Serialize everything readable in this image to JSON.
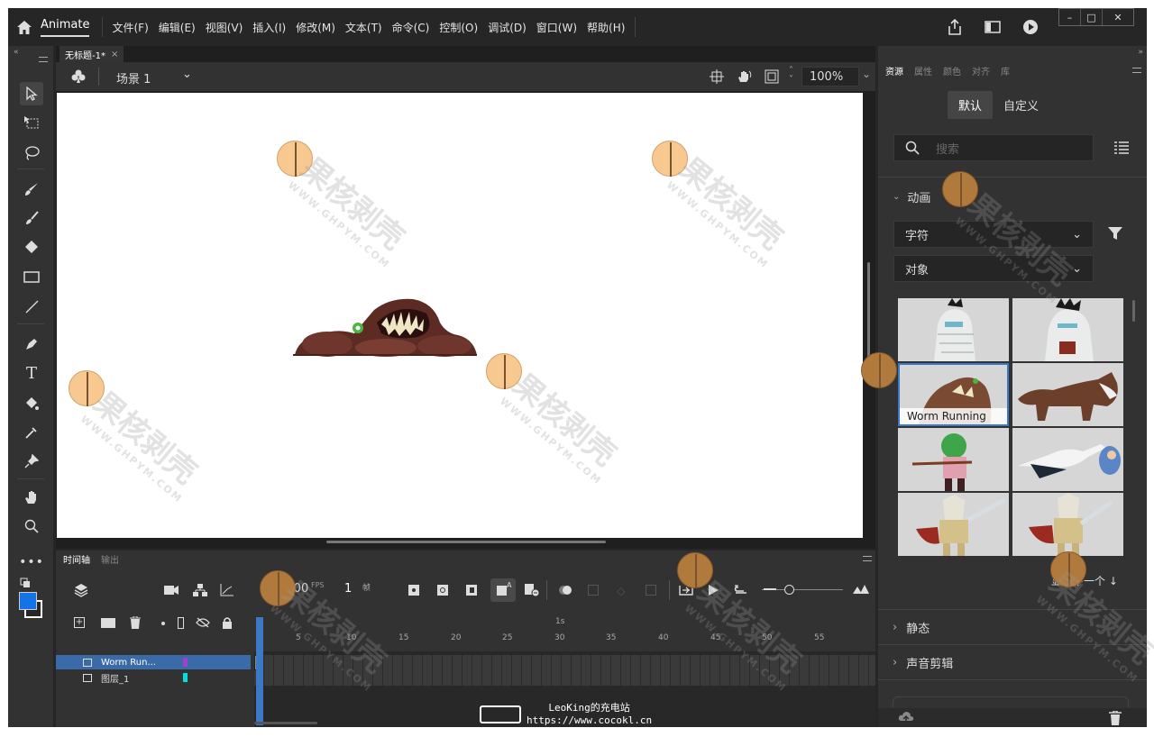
{
  "app": {
    "name": "Animate"
  },
  "menu": [
    "文件(F)",
    "编辑(E)",
    "视图(V)",
    "插入(I)",
    "修改(M)",
    "文本(T)",
    "命令(C)",
    "控制(O)",
    "调试(D)",
    "窗口(W)",
    "帮助(H)"
  ],
  "window_buttons": {
    "minimize": "–",
    "maximize": "□",
    "close": "✕"
  },
  "document": {
    "tab": "无标题-1*",
    "tab_close": "×",
    "scene": "场景 1",
    "zoom": "100%"
  },
  "tools": [
    "selection",
    "free-transform",
    "lasso",
    "paint-brush",
    "brush",
    "eraser",
    "rectangle",
    "line",
    "pen",
    "text",
    "paint-bucket",
    "eyedropper",
    "pin",
    "hand",
    "zoom",
    "more"
  ],
  "colors": {
    "stroke": "#ffffff",
    "fill": "#1473e6",
    "accent": "#3a79c6"
  },
  "timeline": {
    "tabs": [
      "时间轴",
      "输出"
    ],
    "fps": "30.00",
    "fps_unit": "FPS",
    "frame": "1",
    "frame_unit": "帧",
    "ruler_labels": [
      "1s",
      "5",
      "10",
      "15",
      "20",
      "25",
      "30",
      "35",
      "40",
      "45",
      "50",
      "55"
    ],
    "layers": [
      {
        "name": "Worm Run...",
        "color": "#a040d0",
        "selected": true
      },
      {
        "name": "图层_1",
        "color": "#00e0e0",
        "selected": false
      }
    ]
  },
  "assets": {
    "tabs": [
      "资源",
      "属性",
      "颜色",
      "对齐",
      "库"
    ],
    "segments": [
      "默认",
      "自定义"
    ],
    "search_placeholder": "搜索",
    "sections": {
      "animation": "动画",
      "static": "静态",
      "sound": "声音剪辑"
    },
    "filter_type": "字符",
    "filter_object": "对象",
    "selected_label": "Worm Running",
    "show_next": "显示下一个 ↓",
    "thumbnails": [
      "mummy-1",
      "mummy-2",
      "worm-running",
      "wolf",
      "archer",
      "stork",
      "knight-1",
      "knight-2"
    ]
  },
  "watermark": {
    "text": "果核剥壳",
    "sub": "WWW.GHPYM.COM"
  },
  "credit": {
    "line1": "LeoKing的充电站",
    "line2": "https://www.cocokl.cn"
  }
}
